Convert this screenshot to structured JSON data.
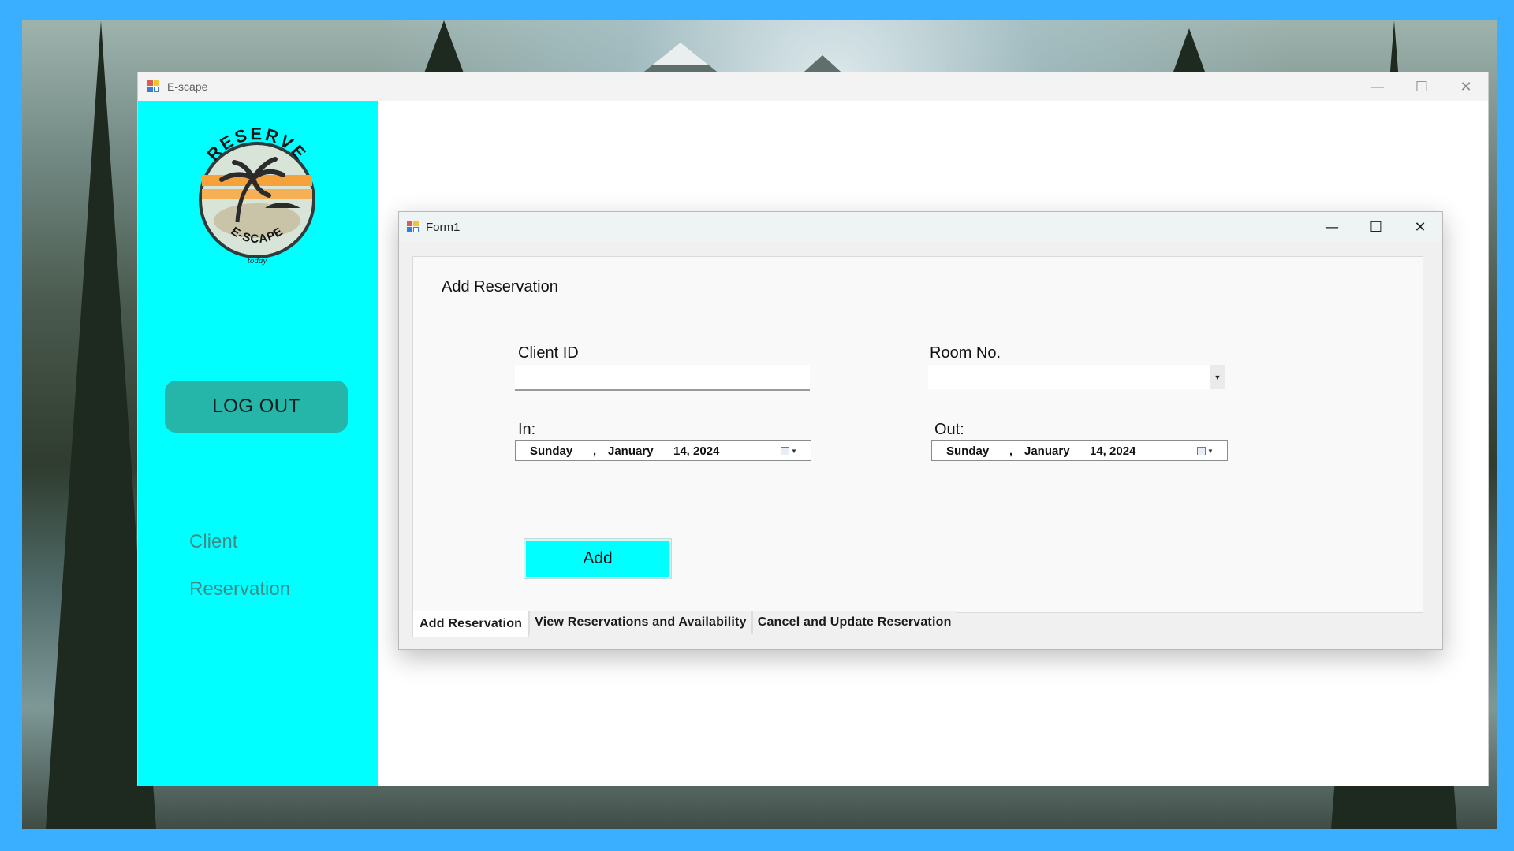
{
  "main_window": {
    "title": "E-scape",
    "controls": {
      "minimize": "—",
      "maximize": "☐",
      "close": "✕"
    }
  },
  "sidebar": {
    "logo": {
      "top_text": "RESERVE",
      "bottom_text": "E-SCAPE",
      "tagline": "today"
    },
    "logout_label": "LOG OUT",
    "nav_items": [
      {
        "label": "Client"
      },
      {
        "label": "Reservation"
      }
    ]
  },
  "form_window": {
    "title": "Form1",
    "controls": {
      "minimize": "—",
      "maximize": "☐",
      "close": "✕"
    },
    "panel_title": "Add Reservation",
    "client_id": {
      "label": "Client ID",
      "value": ""
    },
    "room_no": {
      "label": "Room No.",
      "value": ""
    },
    "check_in": {
      "label": "In:",
      "day": "Sunday",
      "sep": ",",
      "month": "January",
      "date": "14, 2024"
    },
    "check_out": {
      "label": "Out:",
      "day": "Sunday",
      "sep": ",",
      "month": "January",
      "date": "14, 2024"
    },
    "add_label": "Add",
    "tabs": [
      {
        "label": "Add Reservation",
        "active": true
      },
      {
        "label": "View Reservations and Availability",
        "active": false
      },
      {
        "label": "Cancel and Update Reservation",
        "active": false
      }
    ]
  },
  "colors": {
    "desktop_border": "#3aafff",
    "sidebar_bg": "#00ffff",
    "logout_bg": "#26b5a9",
    "nav_text": "#3c8c88",
    "add_button_bg": "#00ffff"
  }
}
